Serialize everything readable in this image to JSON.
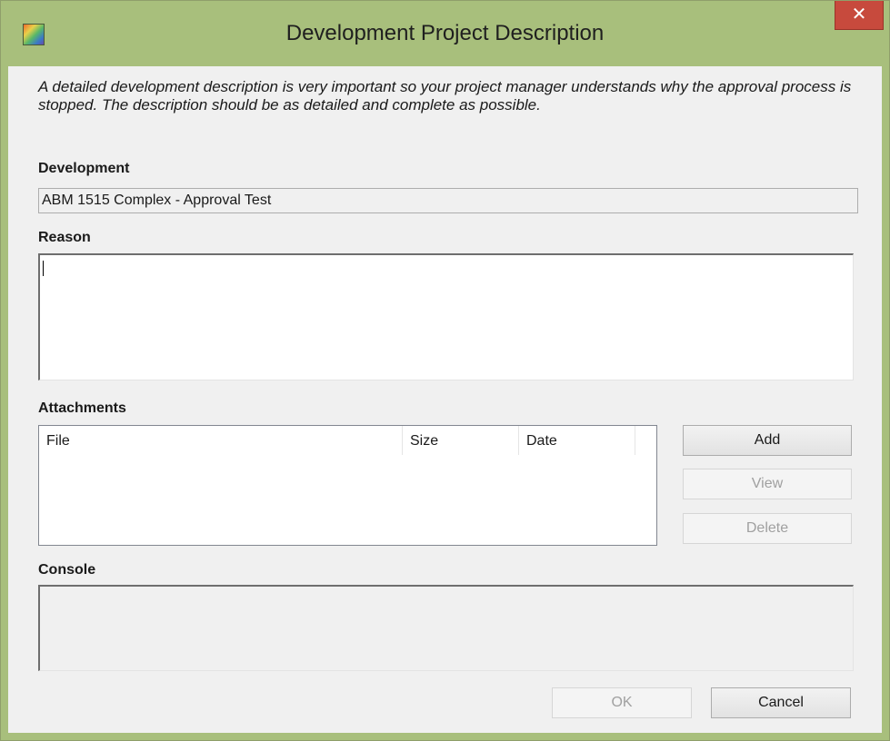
{
  "window": {
    "title": "Development Project Description",
    "close_glyph": "✕",
    "app_icon": "app-icon",
    "close_icon": "close-icon"
  },
  "intro_text": "A detailed development description is very important so your project manager understands why the approval process is stopped. The description should be as detailed and complete as possible.",
  "development": {
    "label": "Development",
    "value": "ABM 1515 Complex - Approval Test"
  },
  "reason": {
    "label": "Reason",
    "value": ""
  },
  "attachments": {
    "label": "Attachments",
    "columns": [
      "File",
      "Size",
      "Date"
    ],
    "rows": [],
    "buttons": {
      "add": "Add",
      "view": "View",
      "delete": "Delete"
    }
  },
  "console": {
    "label": "Console",
    "value": ""
  },
  "footer": {
    "ok": "OK",
    "cancel": "Cancel"
  },
  "colors": {
    "frame": "#a8bf7c",
    "close": "#c74a3d",
    "client": "#f0f0f0"
  }
}
